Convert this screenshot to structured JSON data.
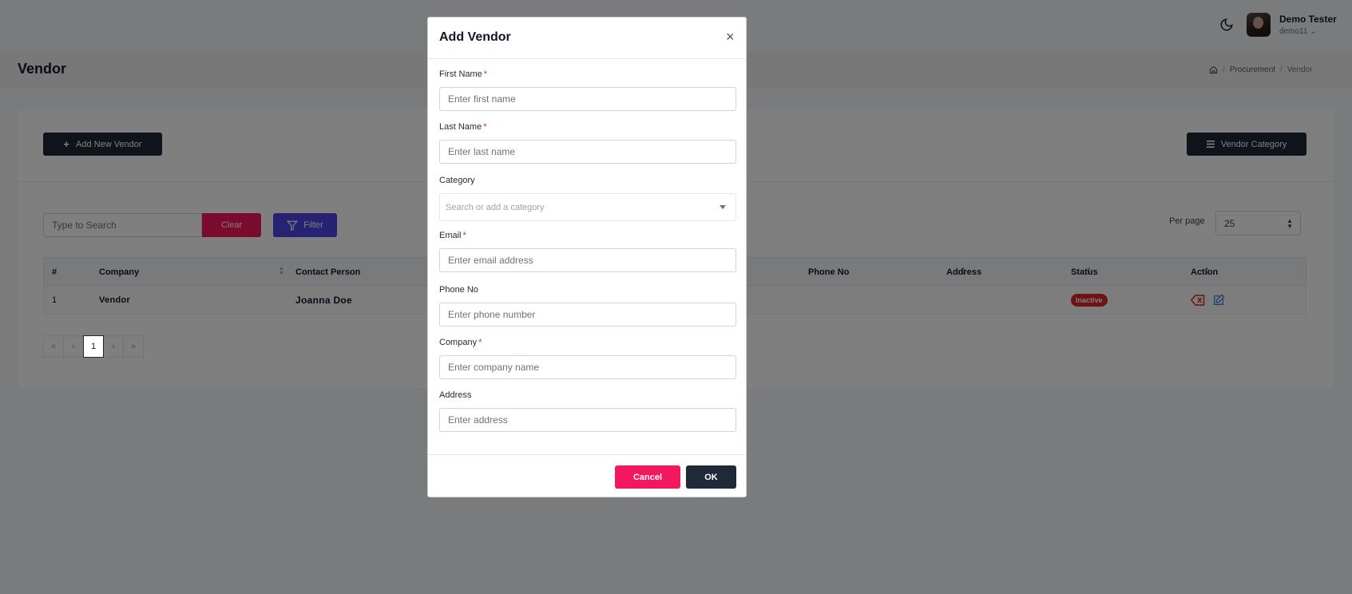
{
  "header": {
    "user_name": "Demo Tester",
    "user_handle": "demo11",
    "icons": {
      "theme": "moon-icon",
      "dropdown": "chevron-down-icon"
    }
  },
  "page": {
    "title": "Vendor",
    "breadcrumb": [
      "Procurement",
      "Vendor"
    ],
    "breadcrumb_sep": "/"
  },
  "toolbar": {
    "add_label": "Add New Vendor",
    "vendor_category_label": "Vendor Category",
    "search_placeholder": "Type to Search",
    "clear_label": "Clear",
    "filter_label": "Filter",
    "per_page_label": "Per page",
    "per_page_value": "25"
  },
  "table": {
    "columns": [
      "#",
      "Company",
      "Contact Person",
      "Phone No",
      "Address",
      "Status",
      "Action"
    ],
    "rows": [
      {
        "index": "1",
        "company": "Vendor",
        "contact": "Joanna Doe",
        "phone": "",
        "address": "",
        "status": "Inactive"
      }
    ]
  },
  "pagination": {
    "first": "«",
    "prev": "‹",
    "current": "1",
    "next": "›",
    "last": "»"
  },
  "modal": {
    "title": "Add Vendor",
    "close": "×",
    "fields": {
      "first_name": {
        "label": "First Name",
        "placeholder": "Enter first name",
        "required": "*"
      },
      "last_name": {
        "label": "Last Name",
        "placeholder": "Enter last name",
        "required": "*"
      },
      "category": {
        "label": "Category",
        "placeholder": "Search or add a category"
      },
      "email": {
        "label": "Email",
        "placeholder": "Enter email address",
        "required": "*"
      },
      "phone": {
        "label": "Phone No",
        "placeholder": "Enter phone number"
      },
      "company": {
        "label": "Company",
        "placeholder": "Enter company name",
        "required": "*"
      },
      "address": {
        "label": "Address",
        "placeholder": "Enter address"
      }
    },
    "cancel_label": "Cancel",
    "ok_label": "OK"
  },
  "colors": {
    "primary_dark": "#1f2937",
    "danger_pink": "#f3175f",
    "filter_indigo": "#4f46e5",
    "status_inactive": "#dc2626"
  }
}
